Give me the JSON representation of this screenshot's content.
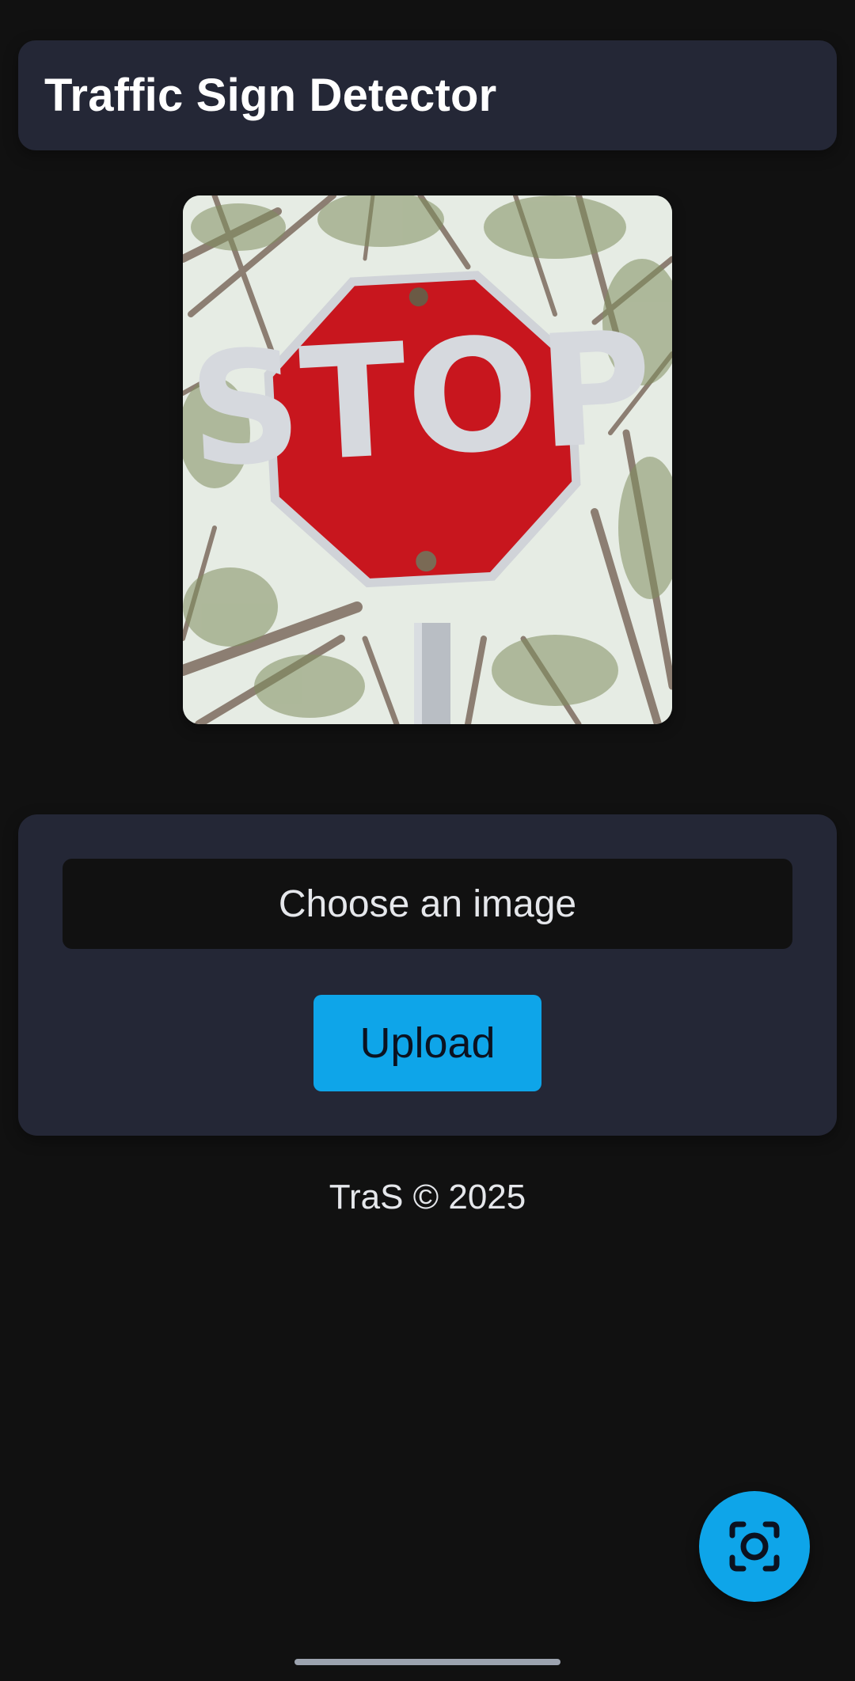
{
  "app": {
    "title": "Traffic Sign Detector"
  },
  "preview": {
    "sign_text": "STOP"
  },
  "upload_panel": {
    "file_picker_label": "Choose an image",
    "upload_label": "Upload"
  },
  "footer": {
    "text": "TraS © 2025"
  },
  "fab": {
    "icon": "camera-icon"
  },
  "colors": {
    "background": "#111111",
    "card": "#242736",
    "accent": "#0ea5e9",
    "sign_red": "#c8161e"
  }
}
